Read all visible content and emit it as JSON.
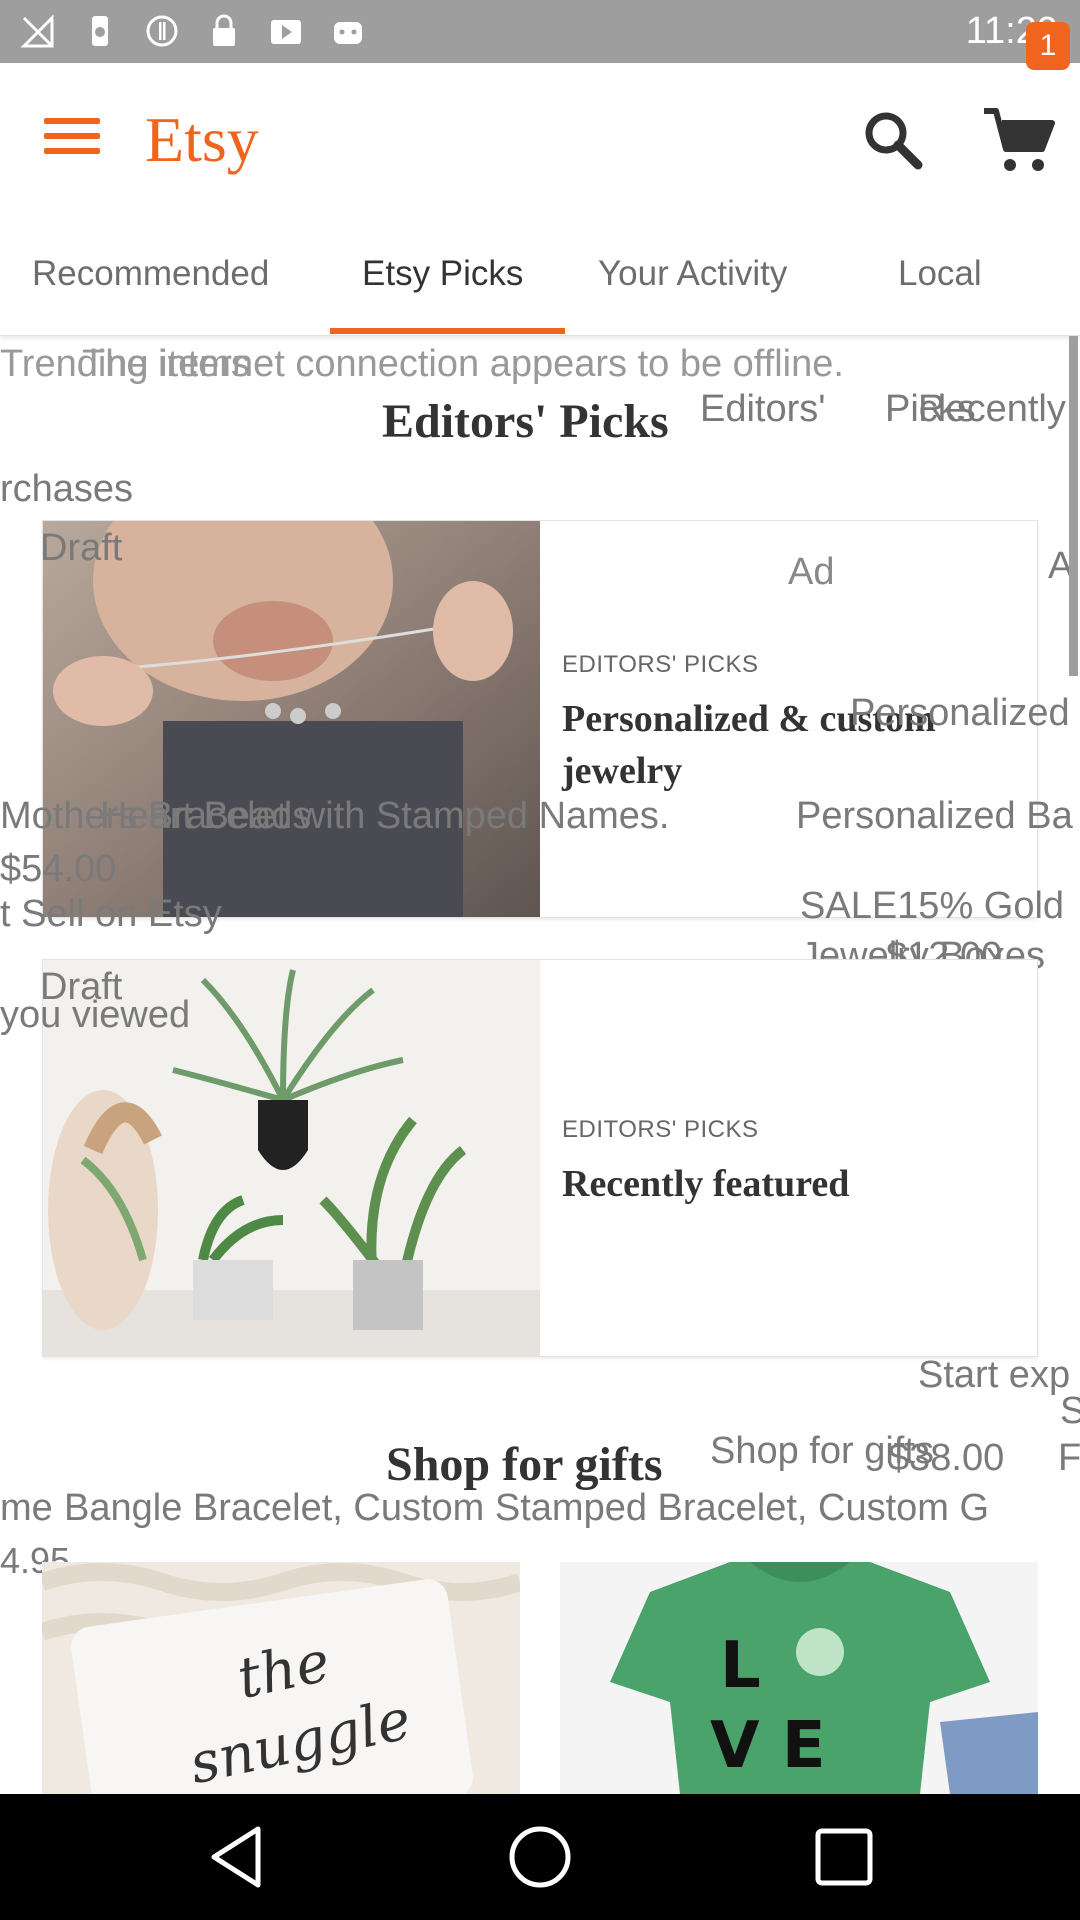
{
  "status_bar": {
    "time": "11:29",
    "icons": [
      "no-signal-icon",
      "cast-icon",
      "battery-icon",
      "wifi-off-icon",
      "lock-icon",
      "media-icon",
      "android-icon"
    ]
  },
  "app_bar": {
    "logo": "Etsy",
    "cart_count": "1",
    "accent_color": "#f1641e"
  },
  "tabs": [
    {
      "label": "Recommended"
    },
    {
      "label": "Etsy Picks",
      "active": true
    },
    {
      "label": "Your Activity"
    },
    {
      "label": "Local"
    }
  ],
  "overlay_text": {
    "line1": "The internet connection appears to be offline.",
    "line1_prefix": "Trending items",
    "line2": "Editors'",
    "line2b": "Picks",
    "line2c": "Recently",
    "line3": "rchases",
    "draft1": "Draft",
    "ad_right": "A",
    "ghost_personalized": "Personalized",
    "ghost_bracelet": "Mothers Bracelet with Stamped Names.",
    "ghost_heart": "Heart Beads",
    "ghost_personalized_b": "Personalized Ba",
    "ghost_price1": "$54.00",
    "ghost_sell": "t Sell on Etsy",
    "ghost_sale": "SALE15% Gold",
    "ghost_jewelry": "Jewelry Boxes",
    "ghost_price2": "$12.00",
    "draft2": "Draft",
    "ghost_viewed": "you viewed",
    "ghost_start": "Start exp",
    "ghost_s": "S",
    "ghost_shop": "Shop for gifts",
    "ghost_price3": "$38.00",
    "ghost_f": "F",
    "ghost_bangle": "Bangle Bracelet, Custom Stamped Bracelet, Custom G",
    "ghost_me": "me",
    "ghost_price4": "4.95"
  },
  "editors_picks": {
    "section_title": "Editors' Picks",
    "cards": [
      {
        "eyebrow": "EDITORS' PICKS",
        "title": "Personalized & custom jewelry",
        "ad": "Ad"
      },
      {
        "eyebrow": "EDITORS' PICKS",
        "title": "Recently featured"
      }
    ]
  },
  "shop_for_gifts": {
    "section_title": "Shop for gifts"
  }
}
